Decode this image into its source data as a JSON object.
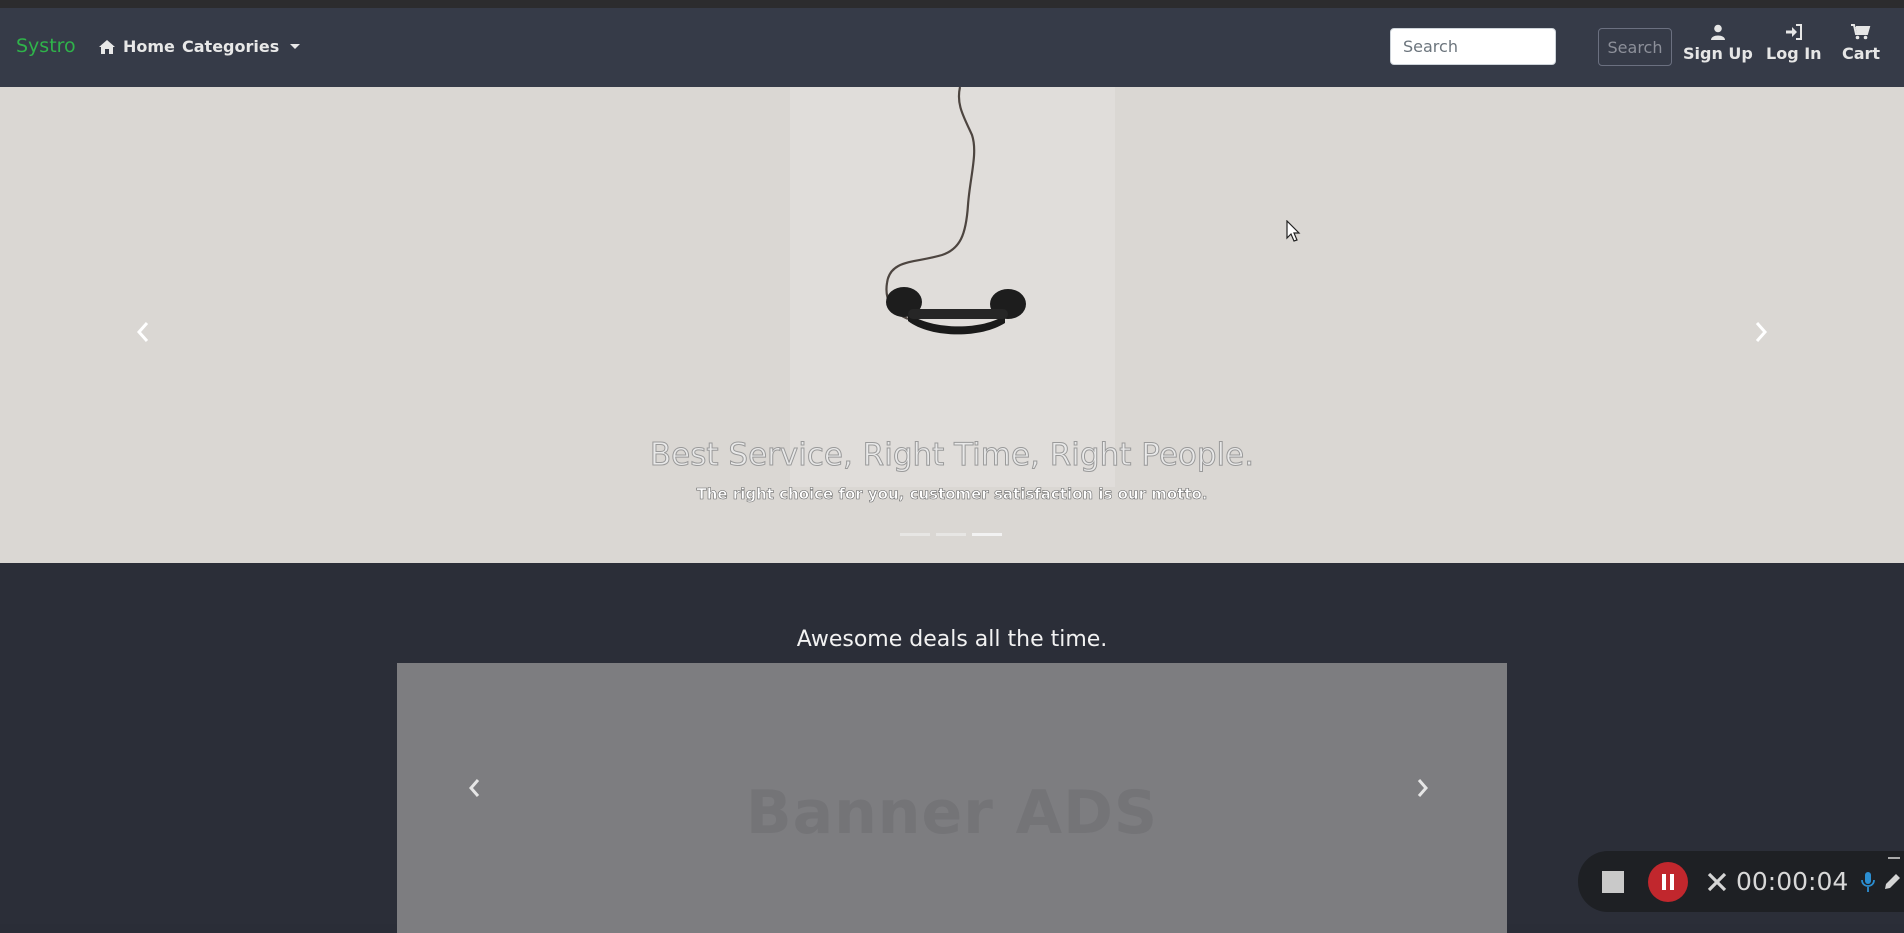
{
  "navbar": {
    "brand": "Systro",
    "home_label": "Home",
    "categories_label": "Categories",
    "search_placeholder": "Search",
    "search_button_label": "Search",
    "signup_label": "Sign Up",
    "login_label": "Log In",
    "cart_label": "Cart"
  },
  "hero": {
    "title": "Best Service, Right Time, Right People.",
    "subtitle": "The right choice for you, customer satisfaction is our motto.",
    "indicators": 3,
    "active_indicator": 3
  },
  "deals": {
    "title": "Awesome deals all the time.",
    "banner_text": "Banner ADS"
  },
  "recorder": {
    "timer": "00:00:04"
  },
  "icons": {
    "home": "home-icon",
    "user": "user-icon",
    "login": "sign-in-icon",
    "cart": "cart-icon",
    "prev": "chevron-left-icon",
    "next": "chevron-right-icon"
  },
  "colors": {
    "brand": "#2fb34a",
    "navbar_bg": "#363b48",
    "hero_bg": "#dad7d3",
    "page_bg": "#2b2e38",
    "record_button": "#c1272d"
  }
}
